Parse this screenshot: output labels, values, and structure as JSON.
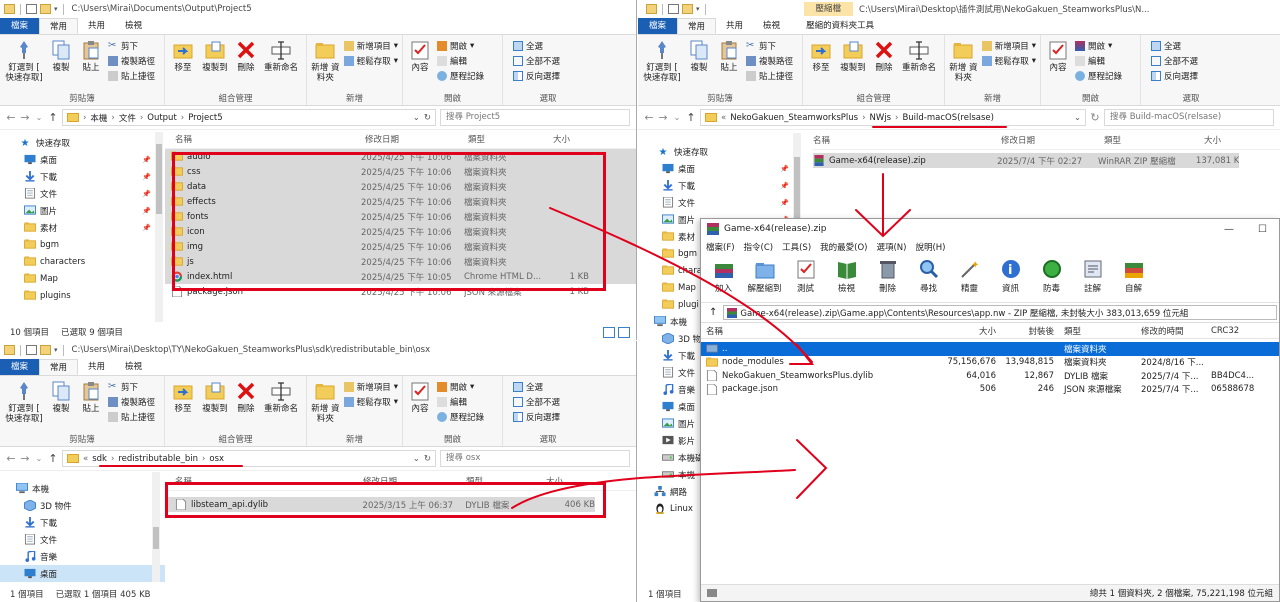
{
  "win1": {
    "title": "C:\\Users\\Mirai\\Documents\\Output\\Project5",
    "tabs": [
      "檔案",
      "常用",
      "共用",
      "檢視"
    ],
    "ribbon": {
      "clipboard": {
        "label": "剪貼簿",
        "pin": "釘選到 [ 快速存取]",
        "copy": "複製",
        "paste": "貼上",
        "cut": "剪下",
        "copy_path": "複製路徑",
        "paste_shortcut": "貼上捷徑"
      },
      "organize": {
        "label": "組合管理",
        "move": "移至",
        "copy_to": "複製到",
        "delete": "刪除",
        "rename": "重新命名"
      },
      "new": {
        "label": "新增",
        "folder": "新增 資料夾",
        "new_item": "新增項目",
        "easy_access": "輕鬆存取"
      },
      "open": {
        "label": "開啟",
        "properties": "內容",
        "open": "開啟",
        "edit": "編輯",
        "history": "歷程記錄"
      },
      "select": {
        "label": "選取",
        "all": "全選",
        "none": "全部不選",
        "invert": "反向選擇"
      }
    },
    "crumbs": [
      "本機",
      "文件",
      "Output",
      "Project5"
    ],
    "search": "搜尋 Project5",
    "nav": [
      {
        "label": "快速存取",
        "icon": "star-icon"
      },
      {
        "label": "桌面",
        "icon": "desktop-icon"
      },
      {
        "label": "下載",
        "icon": "download-icon"
      },
      {
        "label": "文件",
        "icon": "document-icon"
      },
      {
        "label": "圖片",
        "icon": "pictures-icon"
      },
      {
        "label": "素材",
        "icon": "folder-icon"
      },
      {
        "label": "bgm",
        "icon": "folder-icon"
      },
      {
        "label": "characters",
        "icon": "folder-icon"
      },
      {
        "label": "Map",
        "icon": "folder-icon"
      },
      {
        "label": "plugins",
        "icon": "folder-icon"
      }
    ],
    "headers": [
      "名稱",
      "修改日期",
      "類型",
      "大小"
    ],
    "files": [
      {
        "name": "audio",
        "date": "2025/4/25 下午 10:06",
        "type": "檔案資料夾",
        "size": "",
        "icon": "folder-icon"
      },
      {
        "name": "css",
        "date": "2025/4/25 下午 10:06",
        "type": "檔案資料夾",
        "size": "",
        "icon": "folder-icon"
      },
      {
        "name": "data",
        "date": "2025/4/25 下午 10:06",
        "type": "檔案資料夾",
        "size": "",
        "icon": "folder-icon"
      },
      {
        "name": "effects",
        "date": "2025/4/25 下午 10:06",
        "type": "檔案資料夾",
        "size": "",
        "icon": "folder-icon"
      },
      {
        "name": "fonts",
        "date": "2025/4/25 下午 10:06",
        "type": "檔案資料夾",
        "size": "",
        "icon": "folder-icon"
      },
      {
        "name": "icon",
        "date": "2025/4/25 下午 10:06",
        "type": "檔案資料夾",
        "size": "",
        "icon": "folder-icon"
      },
      {
        "name": "img",
        "date": "2025/4/25 下午 10:06",
        "type": "檔案資料夾",
        "size": "",
        "icon": "folder-icon"
      },
      {
        "name": "js",
        "date": "2025/4/25 下午 10:06",
        "type": "檔案資料夾",
        "size": "",
        "icon": "folder-icon"
      },
      {
        "name": "index.html",
        "date": "2025/4/25 下午 10:05",
        "type": "Chrome HTML D...",
        "size": "1 KB",
        "icon": "chrome-icon"
      },
      {
        "name": "package.json",
        "date": "2025/4/25 下午 10:06",
        "type": "JSON 來源檔案",
        "size": "1 KB",
        "icon": "file-icon"
      }
    ],
    "status_count": "10 個項目",
    "status_selected": "已選取 9 個項目"
  },
  "win2": {
    "title": "C:\\Users\\Mirai\\Desktop\\TY\\NekoGakuen_SteamworksPlus\\sdk\\redistributable_bin\\osx",
    "crumbs": [
      "sdk",
      "redistributable_bin",
      "osx"
    ],
    "search": "搜尋 osx",
    "nav": [
      {
        "label": "本機",
        "icon": "pc-icon"
      },
      {
        "label": "3D 物件",
        "icon": "cube-icon"
      },
      {
        "label": "下載",
        "icon": "download-icon"
      },
      {
        "label": "文件",
        "icon": "document-icon"
      },
      {
        "label": "音樂",
        "icon": "music-icon"
      },
      {
        "label": "桌面",
        "icon": "desktop-icon"
      }
    ],
    "files": [
      {
        "name": "libsteam_api.dylib",
        "date": "2025/3/15 上午 06:37",
        "type": "DYLIB 檔案",
        "size": "406 KB",
        "icon": "file-icon"
      }
    ],
    "status_count": "1 個項目",
    "status_selected": "已選取 1 個項目 405 KB"
  },
  "win3": {
    "title": "C:\\Users\\Mirai\\Desktop\\插件測試用\\NekoGakuen_SteamworksPlus\\N...",
    "context_tab": "壓縮檔",
    "context_tool": "壓縮的資料夾工具",
    "crumbs": [
      "NekoGakuen_SteamworksPlus",
      "NWjs",
      "Build-macOS(relsase)"
    ],
    "search": "搜尋 Build-macOS(relsase)",
    "nav": [
      {
        "label": "快速存取",
        "icon": "star-icon"
      },
      {
        "label": "桌面",
        "icon": "desktop-icon"
      },
      {
        "label": "下載",
        "icon": "download-icon"
      },
      {
        "label": "文件",
        "icon": "document-icon"
      },
      {
        "label": "圖片",
        "icon": "pictures-icon"
      },
      {
        "label": "素材",
        "icon": "folder-icon"
      },
      {
        "label": "bgm",
        "icon": "folder-icon"
      },
      {
        "label": "chara",
        "icon": "folder-icon"
      },
      {
        "label": "Map",
        "icon": "folder-icon"
      },
      {
        "label": "plugi",
        "icon": "folder-icon"
      },
      {
        "label": "本機",
        "icon": "pc-icon"
      },
      {
        "label": "3D 物",
        "icon": "cube-icon"
      },
      {
        "label": "下載",
        "icon": "download-icon"
      },
      {
        "label": "文件",
        "icon": "document-icon"
      },
      {
        "label": "音樂",
        "icon": "music-icon"
      },
      {
        "label": "桌面",
        "icon": "desktop-icon"
      },
      {
        "label": "圖片",
        "icon": "pictures-icon"
      },
      {
        "label": "影片",
        "icon": "video-icon"
      },
      {
        "label": "本機磁",
        "icon": "drive-icon"
      },
      {
        "label": "本機",
        "icon": "drive-icon"
      },
      {
        "label": "網路",
        "icon": "network-icon"
      },
      {
        "label": "Linux",
        "icon": "linux-icon"
      }
    ],
    "files": [
      {
        "name": "Game-x64(release).zip",
        "date": "2025/7/4 下午 02:27",
        "type": "WinRAR ZIP 壓縮檔",
        "size": "137,081 KB",
        "icon": "winrar-icon"
      }
    ],
    "status_count": "1 個項目"
  },
  "winrar": {
    "title": "Game-x64(release).zip",
    "menu": [
      "檔案(F)",
      "指令(C)",
      "工具(S)",
      "我的最愛(O)",
      "選項(N)",
      "說明(H)"
    ],
    "toolbar": [
      {
        "label": "加入",
        "icon": "add-icon"
      },
      {
        "label": "解壓縮到",
        "icon": "extract-icon"
      },
      {
        "label": "測試",
        "icon": "test-icon"
      },
      {
        "label": "檢視",
        "icon": "view-icon"
      },
      {
        "label": "刪除",
        "icon": "trash-icon"
      },
      {
        "label": "尋找",
        "icon": "find-icon"
      },
      {
        "label": "精靈",
        "icon": "wizard-icon"
      },
      {
        "label": "資訊",
        "icon": "info-icon"
      },
      {
        "label": "防毒",
        "icon": "virus-icon"
      },
      {
        "label": "註解",
        "icon": "comment-icon"
      },
      {
        "label": "自解",
        "icon": "sfx-icon"
      }
    ],
    "path": "Game-x64(release).zip\\Game.app\\Contents\\Resources\\app.nw - ZIP 壓縮檔, 未封裝大小 383,013,659 位元組",
    "headers": [
      "名稱",
      "大小",
      "封裝後",
      "類型",
      "修改的時間",
      "CRC32"
    ],
    "rows": [
      {
        "name": "..",
        "size": "",
        "packed": "",
        "type": "檔案資料夾",
        "modified": "",
        "crc": "",
        "icon": "folder-up-icon"
      },
      {
        "name": "node_modules",
        "size": "75,156,676",
        "packed": "13,948,815",
        "type": "檔案資料夾",
        "modified": "2024/8/16 下...",
        "crc": "",
        "icon": "folder-icon"
      },
      {
        "name": "NekoGakuen_SteamworksPlus.dylib",
        "size": "64,016",
        "packed": "12,867",
        "type": "DYLIB 檔案",
        "modified": "2025/7/4 下...",
        "crc": "BB4DC4...",
        "icon": "file-icon"
      },
      {
        "name": "package.json",
        "size": "506",
        "packed": "246",
        "type": "JSON 來源檔案",
        "modified": "2025/7/4 下...",
        "crc": "06588678",
        "icon": "file-icon"
      }
    ],
    "status": "總共 1 個資料夾, 2 個檔案, 75,221,198 位元組"
  },
  "colors": {
    "accent": "#1a5fb4",
    "annotation": "#e0001b",
    "selection": "#cce4f7",
    "highlight": "#d9d9d9"
  }
}
